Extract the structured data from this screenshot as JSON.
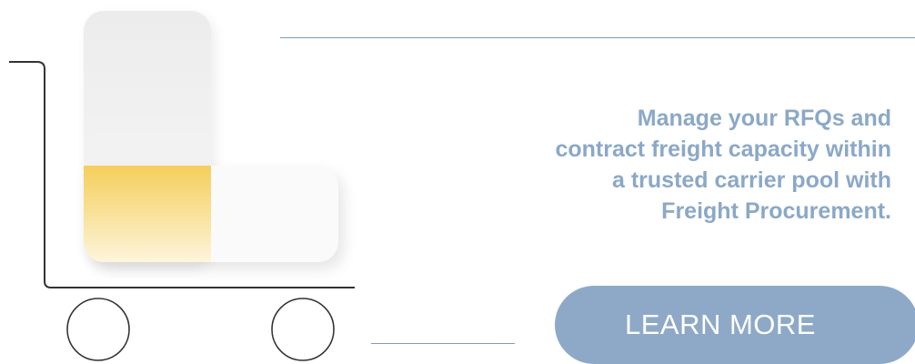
{
  "headline": {
    "lines": [
      "Manage your RFQs and",
      "contract freight capacity within",
      "a trusted carrier pool with",
      "Freight Procurement."
    ]
  },
  "cta": {
    "label": "LEARN MORE"
  },
  "colors": {
    "accent": "#8ea9c7",
    "headline_text": "#8ba8c7",
    "rule": "#7f9cb8",
    "cart_stroke": "#333333",
    "yellow": "#f5cf5c"
  },
  "icons": {
    "illustration": "shopping-cart-icon"
  }
}
